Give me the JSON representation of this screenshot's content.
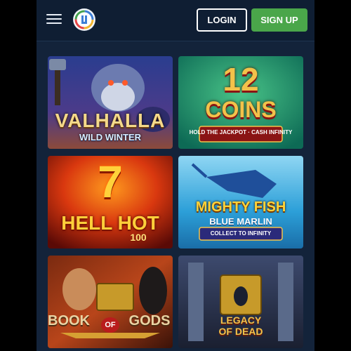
{
  "header": {
    "login_label": "LOGIN",
    "signup_label": "SIGN UP",
    "colors": {
      "signup_bg": "#4aa64a",
      "header_bg": "#0f1e33"
    }
  },
  "games": [
    {
      "title": "VALHALLA",
      "subtitle": "WILD WINTER",
      "extra": ""
    },
    {
      "title": "12",
      "subtitle": "COINS",
      "extra": "HOLD THE JACKPOT · CASH INFINITY"
    },
    {
      "title": "7",
      "subtitle": "HELL HOT",
      "extra": "100"
    },
    {
      "title": "MIGHTY FISH",
      "subtitle": "BLUE MARLIN",
      "extra": "COLLECT TO INFINITY"
    },
    {
      "title": "BOOK",
      "subtitle": "OF",
      "extra": "GODS"
    },
    {
      "title": "LEGACY",
      "subtitle": "OF DEAD",
      "extra": ""
    }
  ]
}
